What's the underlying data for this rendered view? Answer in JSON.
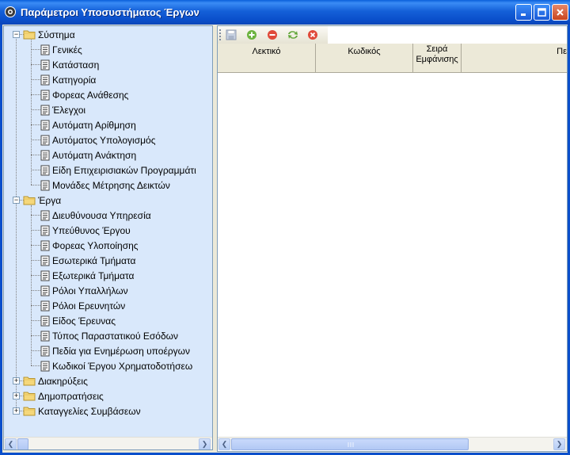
{
  "window": {
    "title": "Παράμετροι Υποσυστήματος Έργων",
    "icons": [
      "app-gear-icon",
      "minimize-icon",
      "maximize-icon",
      "close-icon"
    ]
  },
  "tree": {
    "groups": [
      {
        "label": "Σύστημα",
        "expanded": true,
        "items": [
          "Γενικές",
          "Κατάσταση",
          "Κατηγορία",
          "Φορεας Ανάθεσης",
          "Έλεγχοι",
          "Αυτόματη Αρίθμηση",
          "Αυτόματος Υπολογισμός",
          "Αυτόματη Ανάκτηση",
          "Είδη Επιχειρισιακών Προγραμμάτι",
          "Μονάδες Μέτρησης Δεικτών"
        ]
      },
      {
        "label": "Έργα",
        "expanded": true,
        "items": [
          "Διευθύνουσα Υπηρεσία",
          "Υπεύθυνος Έργου",
          "Φορεας Υλοποίησης",
          "Εσωτερικά Τμήματα",
          "Εξωτερικά Τμήματα",
          "Ρόλοι Υπαλλήλων",
          "Ρόλοι Ερευνητών",
          "Είδος Έρευνας",
          "Τύπος Παραστατικού Εσόδων",
          "Πεδία για Ενημέρωση υποέργων",
          "Κωδικοί Έργου Χρηματοδοτήσεω"
        ]
      },
      {
        "label": "Διακηρύξεις",
        "expanded": false,
        "items": []
      },
      {
        "label": "Δημοπρατήσεις",
        "expanded": false,
        "items": []
      },
      {
        "label": "Καταγγελίες Συμβάσεων",
        "expanded": false,
        "items": []
      }
    ]
  },
  "toolbar": {
    "buttons": [
      "save-icon",
      "add-icon",
      "delete-icon",
      "refresh-icon",
      "cancel-icon"
    ]
  },
  "grid": {
    "columns": [
      "Λεκτικό",
      "Κωδικός",
      "Σειρά Εμφάνισης",
      "Πε"
    ]
  },
  "colors": {
    "title_bar": "#0A5FDB",
    "tree_background": "#D9E8FB",
    "add_button": "#6CB33F",
    "delete_button": "#E04A3A"
  }
}
